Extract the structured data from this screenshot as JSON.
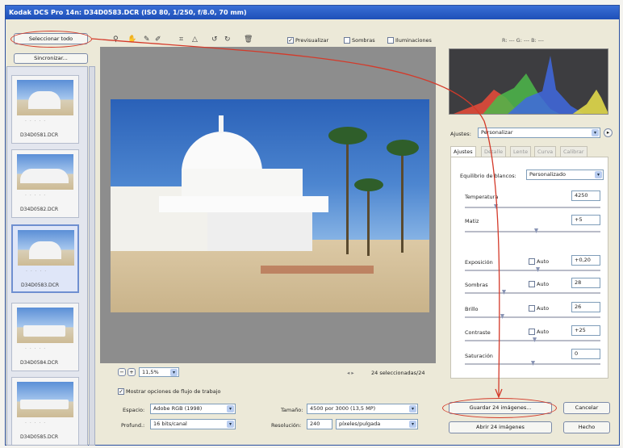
{
  "window": {
    "title": "Kodak DCS Pro 14n:  D34D0583.DCR  (ISO 80, 1/250, f/8.0, 70 mm)"
  },
  "buttons": {
    "select_all": "Seleccionar todo",
    "sync": "Sincronizar...",
    "save": "Guardar 24 imágenes...",
    "cancel": "Cancelar",
    "open": "Abrir 24 imágenes",
    "done": "Hecho"
  },
  "toolbar": {
    "preview": "Previsualizar",
    "preview_checked": "✓",
    "shadows": "Sombras",
    "highlights": "Iluminaciones",
    "rgb": "R: ---   G: ---   B: ---"
  },
  "filmstrip": [
    {
      "name": "D34D0581.DCR"
    },
    {
      "name": "D34D0582.DCR"
    },
    {
      "name": "D34D0583.DCR"
    },
    {
      "name": "D34D0584.DCR"
    },
    {
      "name": "D34D0585.DCR"
    }
  ],
  "thumb_stars": "· · · · ·",
  "status": {
    "zoom": "11,5%",
    "selection": "24 seleccionadas/24"
  },
  "workflow": {
    "checkbox_label": "Mostrar opciones de flujo de trabajo",
    "checkbox_checked": "✓",
    "space_label": "Espacio:",
    "space_value": "Adobe RGB (1998)",
    "depth_label": "Profund.:",
    "depth_value": "16 bits/canal",
    "size_label": "Tamaño:",
    "size_value": "4500 por 3000 (13,5 MP)",
    "res_label": "Resolución:",
    "res_value": "240",
    "res_unit": "píxeles/pulgada"
  },
  "settings": {
    "label": "Ajustes:",
    "value": "Personalizar"
  },
  "tabs": [
    "Ajustes",
    "Detalle",
    "Lente",
    "Curva",
    "Calibrar"
  ],
  "adjust": {
    "wb_label": "Equilibrio de blancos:",
    "wb_value": "Personalizado",
    "auto": "Auto",
    "temp_label": "Temperatura",
    "temp": "4250",
    "tint_label": "Matiz",
    "tint": "+5",
    "exp_label": "Exposición",
    "exp": "+0,20",
    "shadows_label": "Sombras",
    "shadows": "28",
    "bright_label": "Brillo",
    "bright": "26",
    "contrast_label": "Contraste",
    "contrast": "+25",
    "sat_label": "Saturación",
    "sat": "0"
  },
  "colors": {
    "titlebar": "#1e4fb8",
    "annotation": "#d43a2a"
  }
}
